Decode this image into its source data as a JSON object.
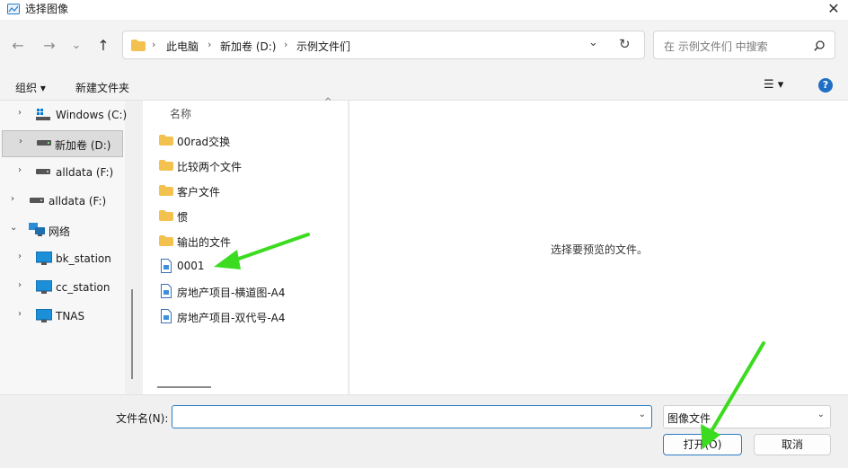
{
  "window": {
    "title": "选择图像",
    "close_glyph": "✕"
  },
  "nav": {
    "back": "←",
    "forward": "→",
    "recent": "⌄",
    "up": "↑",
    "refresh": "↻"
  },
  "address": {
    "crumbs": [
      "此电脑",
      "新加卷 (D:)",
      "示例文件们"
    ],
    "sep": "›",
    "dropdown": "⌄"
  },
  "search": {
    "placeholder": "在 示例文件们 中搜索"
  },
  "toolbar": {
    "organize": "组织 ▾",
    "new_folder": "新建文件夹",
    "view_glyph": "☰ ▾",
    "help": "?"
  },
  "sidebar": {
    "items": [
      {
        "label": "Windows (C:)",
        "icon": "windows-drive-icon",
        "chevron": "›"
      },
      {
        "label": "新加卷 (D:)",
        "icon": "drive-icon",
        "chevron": "›"
      },
      {
        "label": "alldata (F:)",
        "icon": "drive-icon",
        "chevron": "›"
      },
      {
        "label": "alldata (F:)",
        "icon": "drive-icon",
        "chevron": "›"
      },
      {
        "label": "网络",
        "icon": "network-icon",
        "chevron": "⌄"
      },
      {
        "label": "bk_station",
        "icon": "computer-icon",
        "chevron": "›"
      },
      {
        "label": "cc_station",
        "icon": "computer-icon",
        "chevron": "›"
      },
      {
        "label": "TNAS",
        "icon": "computer-icon",
        "chevron": "›"
      }
    ]
  },
  "filelist": {
    "header": "名称",
    "sort_glyph": "^",
    "items": [
      {
        "name": "00rad交换",
        "type": "folder"
      },
      {
        "name": "比较两个文件",
        "type": "folder"
      },
      {
        "name": "客户文件",
        "type": "folder"
      },
      {
        "name": "惯",
        "type": "folder"
      },
      {
        "name": "输出的文件",
        "type": "folder"
      },
      {
        "name": "0001",
        "type": "image"
      },
      {
        "name": "房地产项目-横道图-A4",
        "type": "image"
      },
      {
        "name": "房地产项目-双代号-A4",
        "type": "image"
      }
    ]
  },
  "preview": {
    "message": "选择要预览的文件。"
  },
  "bottom": {
    "filename_label": "文件名(N):",
    "filename_value": "",
    "filetype_value": "图像文件",
    "dropdown": "⌄",
    "open_label": "打开(O)",
    "cancel_label": "取消"
  },
  "colors": {
    "accent": "#2b7cc4",
    "annotation_arrow": "#3bdc1f",
    "folder": "#f2c14e"
  }
}
